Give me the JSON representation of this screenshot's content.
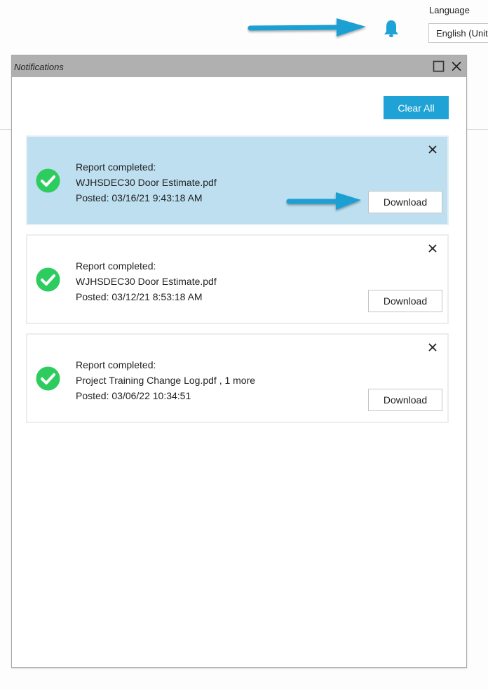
{
  "header": {
    "language_label": "Language",
    "language_value": "English (United States)",
    "bell_icon": "bell-icon",
    "accent_color": "#1fa3d6"
  },
  "panel": {
    "title": "Notifications",
    "maximize_icon": "maximize-icon",
    "close_icon": "close-icon",
    "clear_all_label": "Clear All",
    "notifications": [
      {
        "status_icon": "check-circle-icon",
        "title": "Report completed:",
        "file": "WJHSDEC30 Door Estimate.pdf",
        "posted": "Posted: 03/16/21 9:43:18 AM",
        "download_label": "Download",
        "highlighted": true
      },
      {
        "status_icon": "check-circle-icon",
        "title": "Report completed:",
        "file": "WJHSDEC30 Door Estimate.pdf",
        "posted": "Posted: 03/12/21 8:53:18 AM",
        "download_label": "Download",
        "highlighted": false
      },
      {
        "status_icon": "check-circle-icon",
        "title": "Report completed:",
        "file": "Project Training Change Log.pdf , 1 more",
        "posted": "Posted: 03/06/22 10:34:51",
        "download_label": "Download",
        "highlighted": false
      }
    ]
  },
  "colors": {
    "highlight_bg": "#bddff0",
    "success_green": "#2ecc5e",
    "titlebar_gray": "#b0b0b0",
    "annotation_arrow": "#1a9fd3"
  }
}
